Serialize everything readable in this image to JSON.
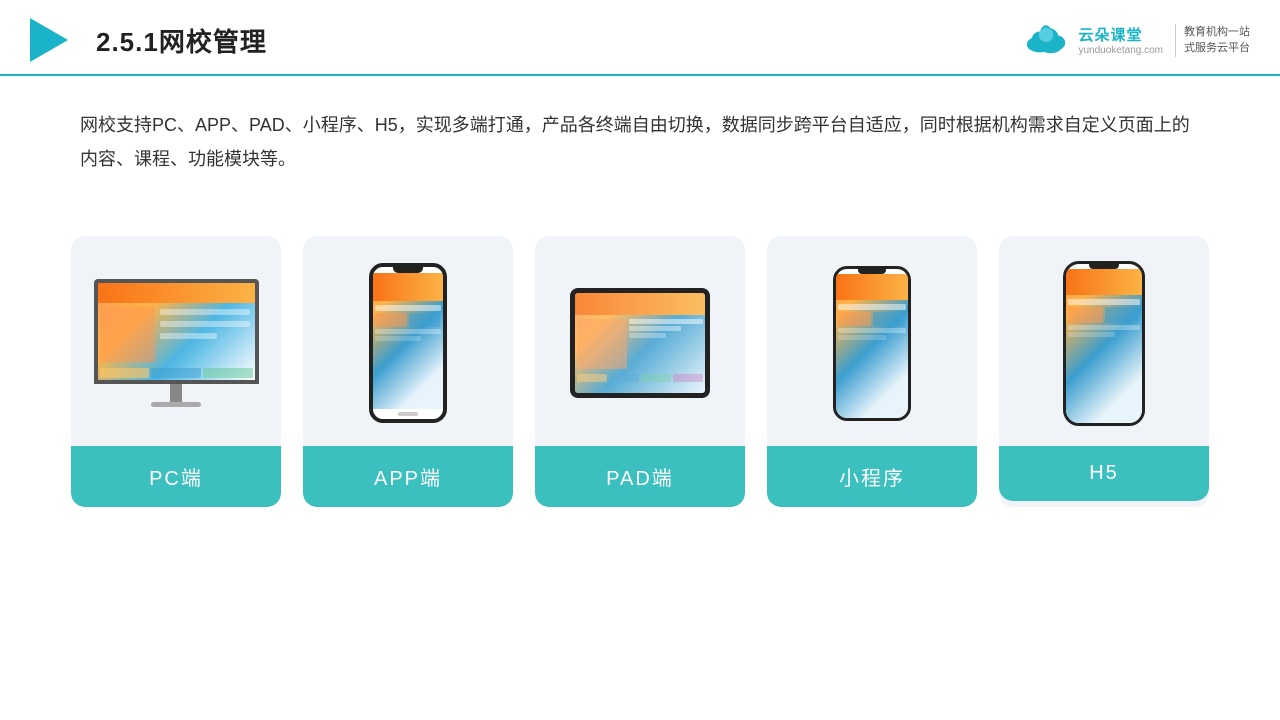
{
  "header": {
    "title": "2.5.1网校管理",
    "logo_name": "云朵课堂",
    "logo_url": "yunduoketang.com",
    "logo_slogan_line1": "教育机构一站",
    "logo_slogan_line2": "式服务云平台"
  },
  "description": {
    "text": "网校支持PC、APP、PAD、小程序、H5，实现多端打通，产品各终端自由切换，数据同步跨平台自适应，同时根据机构需求自定义页面上的内容、课程、功能模块等。"
  },
  "cards": [
    {
      "id": "pc",
      "label": "PC端",
      "type": "pc"
    },
    {
      "id": "app",
      "label": "APP端",
      "type": "phone"
    },
    {
      "id": "pad",
      "label": "PAD端",
      "type": "pad"
    },
    {
      "id": "miniapp",
      "label": "小程序",
      "type": "miniapp"
    },
    {
      "id": "h5",
      "label": "H5",
      "type": "h5"
    }
  ],
  "colors": {
    "accent": "#1ab3c8",
    "card_bg": "#f0f4f8",
    "card_label_bg": "#3bbfbf",
    "header_line": "#1ab3c8"
  }
}
